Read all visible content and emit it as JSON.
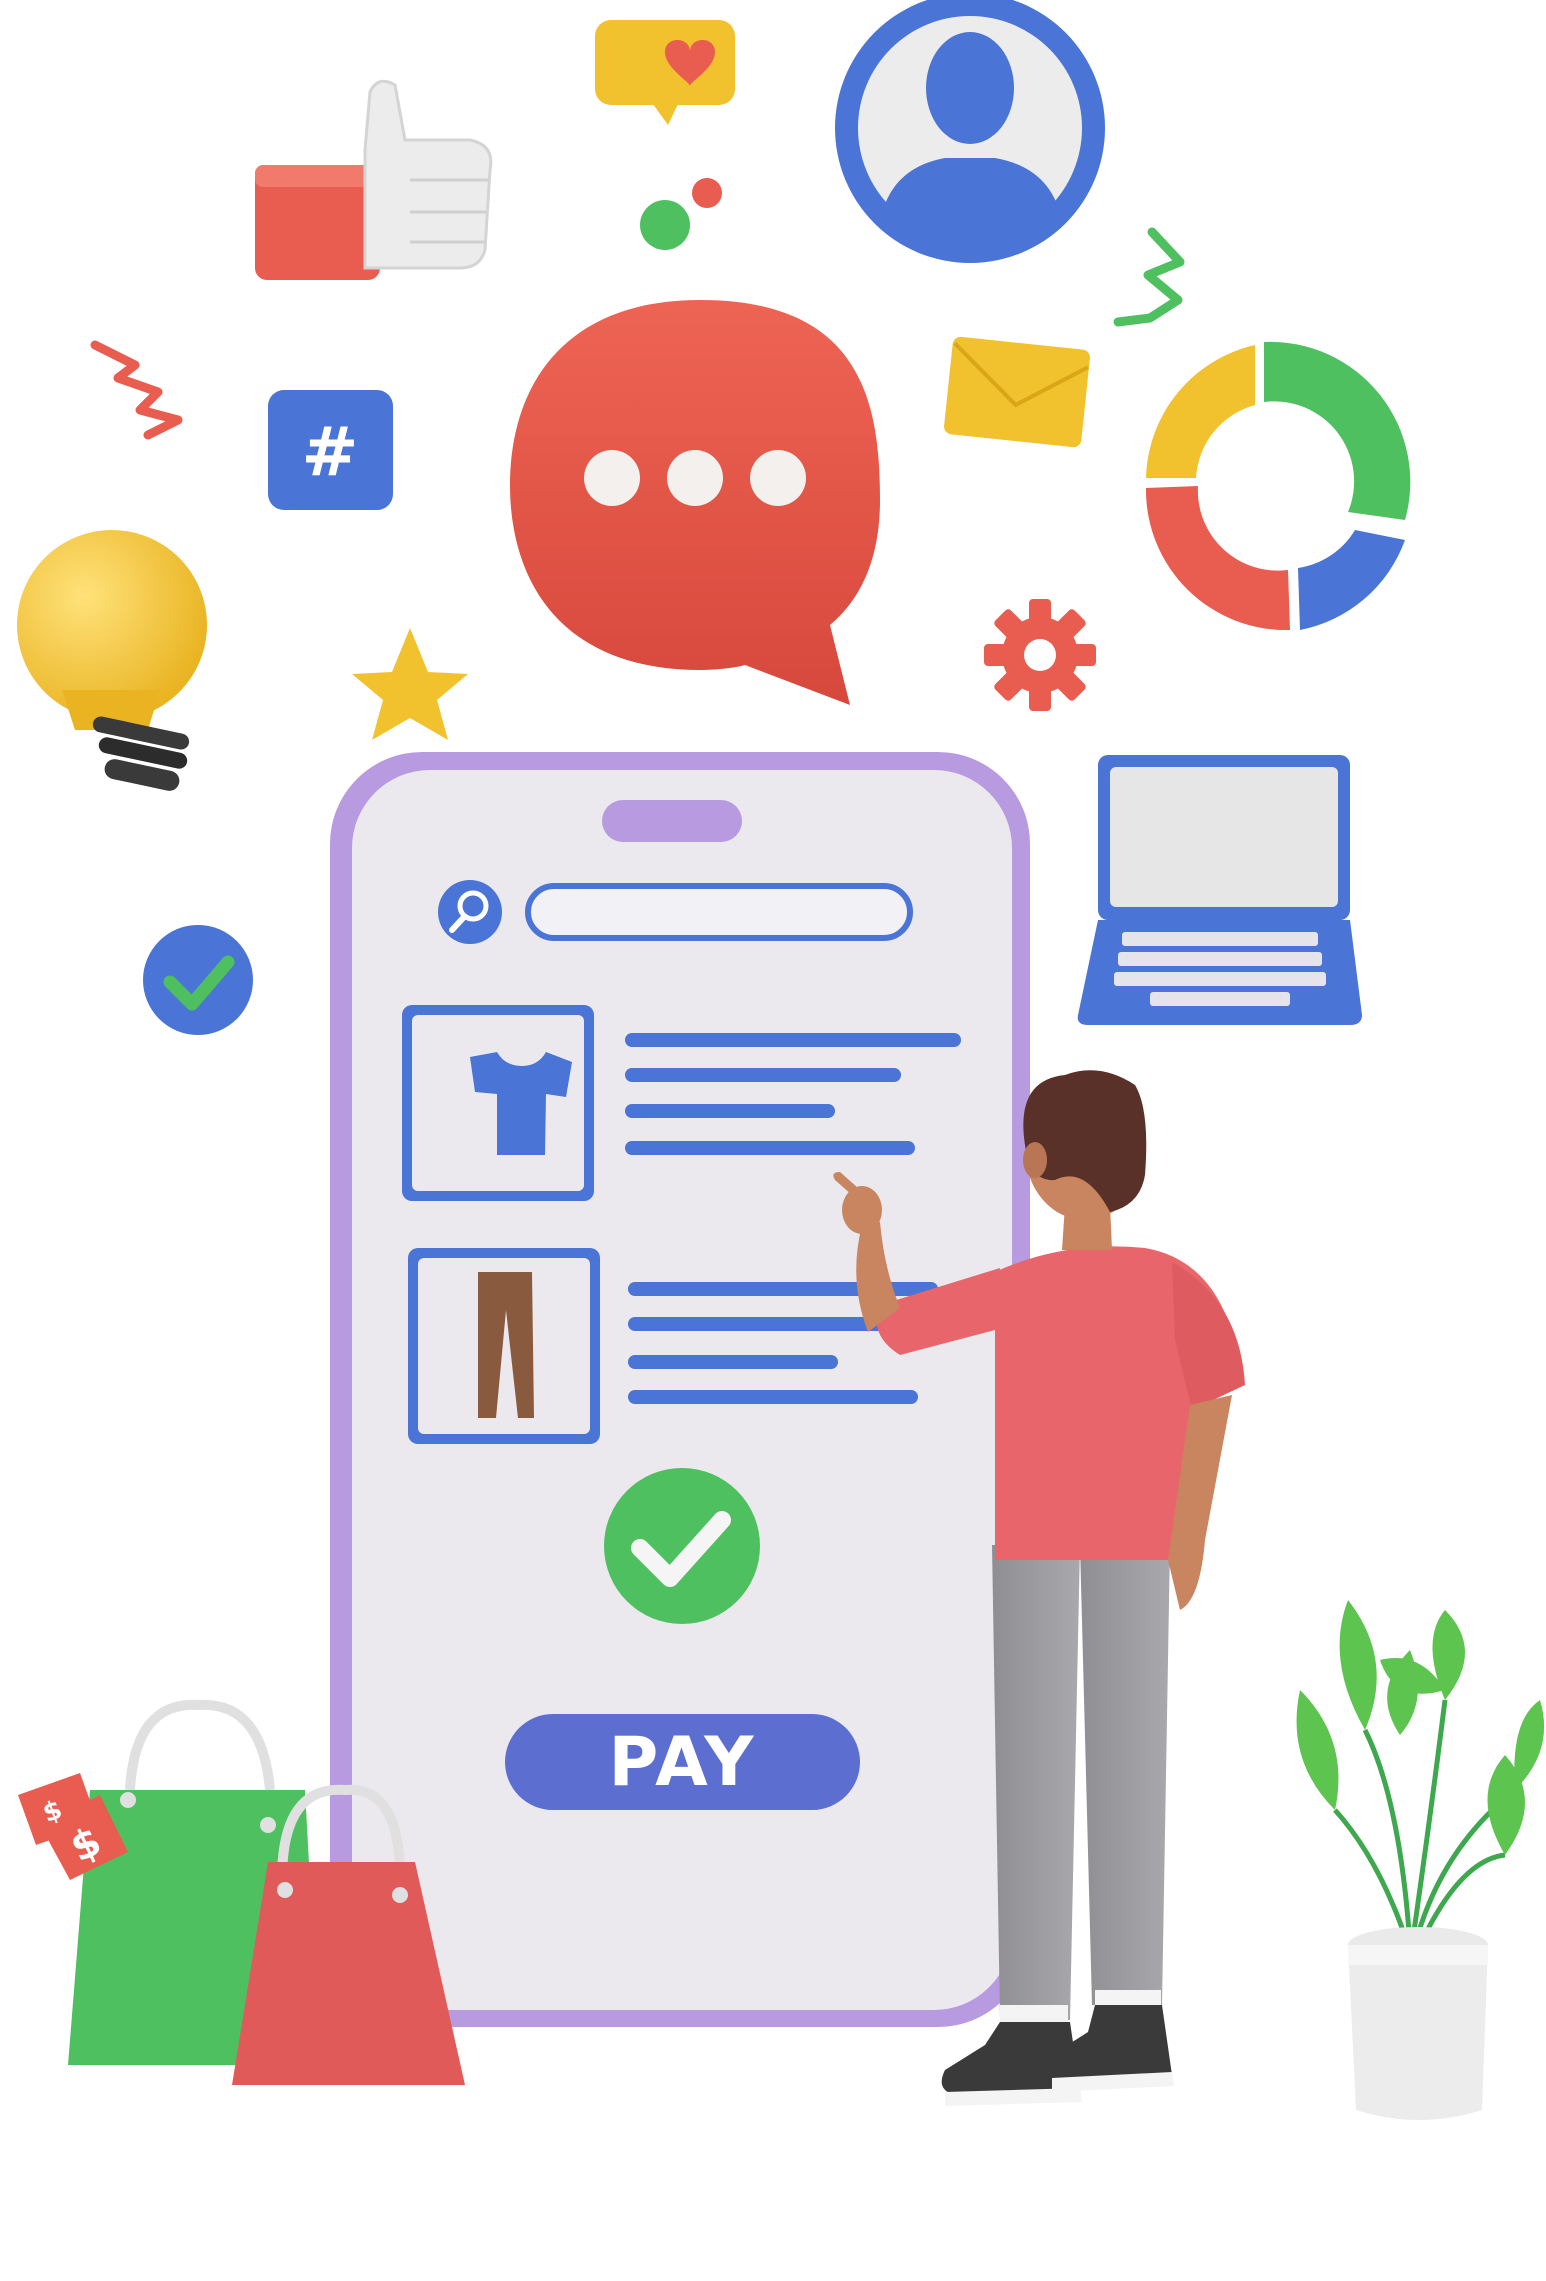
{
  "phone": {
    "pay_button_label": "PAY"
  },
  "icons": {
    "hashtag": "#",
    "price_tag_front": "$",
    "price_tag_back": "$"
  },
  "colors": {
    "brand_blue": "#4a74d6",
    "phone_frame": "#b79ae0",
    "screen": "#ebe9ee",
    "accent_red": "#e05245",
    "accent_green": "#4fc060",
    "accent_yellow": "#f2c12e"
  }
}
